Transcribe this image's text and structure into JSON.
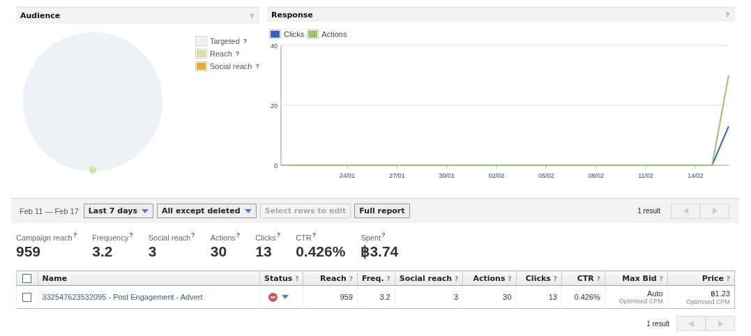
{
  "audience": {
    "title": "Audience",
    "help": "?",
    "legend": [
      {
        "label": "Targeted",
        "help": "?",
        "color": "#edf0f5"
      },
      {
        "label": "Reach",
        "help": "?",
        "color": "#cfe4a2"
      },
      {
        "label": "Social reach",
        "help": "?",
        "color": "#e8a82a"
      }
    ]
  },
  "response": {
    "title": "Response",
    "help": "?",
    "chart_data": {
      "type": "line",
      "legend": "top",
      "categories": [
        null,
        null,
        null,
        null,
        "24/01",
        null,
        null,
        "27/01",
        null,
        null,
        "30/01",
        null,
        null,
        "02/02",
        null,
        null,
        "05/02",
        null,
        null,
        "08/02",
        null,
        null,
        "11/02",
        null,
        null,
        "14/02",
        null,
        null
      ],
      "ylim": [
        0,
        40
      ],
      "yticks": [
        0,
        20,
        40
      ],
      "series": [
        {
          "name": "Clicks",
          "color": "#3a5fbd",
          "values": [
            null,
            null,
            null,
            null,
            null,
            null,
            null,
            null,
            null,
            null,
            null,
            null,
            null,
            null,
            null,
            null,
            null,
            null,
            null,
            null,
            null,
            null,
            null,
            null,
            null,
            null,
            0,
            13
          ]
        },
        {
          "name": "Actions",
          "color": "#9dc16a",
          "values": [
            0,
            0,
            0,
            0,
            0,
            0,
            0,
            0,
            0,
            0,
            0,
            0,
            0,
            0,
            0,
            0,
            0,
            0,
            0,
            0,
            0,
            0,
            0,
            0,
            0,
            0,
            0,
            30
          ]
        }
      ]
    }
  },
  "toolbar": {
    "date_range": "Feb 11 — Feb 17",
    "buttons": [
      {
        "label": "Last 7 days",
        "kind": "dropdown",
        "disabled": false
      },
      {
        "label": "All except deleted",
        "kind": "dropdown",
        "disabled": false
      },
      {
        "label": "Select rows to edit",
        "kind": "plain",
        "disabled": true
      },
      {
        "label": "Full report",
        "kind": "plain",
        "disabled": false
      }
    ],
    "result_count": "1 result"
  },
  "stats": [
    {
      "label": "Campaign reach",
      "help": "?",
      "value": "959"
    },
    {
      "label": "Frequency",
      "help": "?",
      "value": "3.2"
    },
    {
      "label": "Social reach",
      "help": "?",
      "value": "3"
    },
    {
      "label": "Actions",
      "help": "?",
      "value": "30"
    },
    {
      "label": "Clicks",
      "help": "?",
      "value": "13"
    },
    {
      "label": "CTR",
      "help": "?",
      "value": "0.426%"
    },
    {
      "label": "Spent",
      "help": "?",
      "value": "฿3.74"
    }
  ],
  "table": {
    "select_all": {
      "checked": false
    },
    "columns": [
      {
        "label": "Name"
      },
      {
        "label": "Status",
        "help": "?"
      },
      {
        "label": "Reach",
        "help": "?"
      },
      {
        "label": "Freq.",
        "help": "?"
      },
      {
        "label": "Social reach",
        "help": "?"
      },
      {
        "label": "Actions",
        "help": "?"
      },
      {
        "label": "Clicks",
        "help": "?"
      },
      {
        "label": "CTR",
        "help": "?"
      },
      {
        "label": "Max Bid",
        "help": "?"
      },
      {
        "label": "Price",
        "help": "?"
      }
    ],
    "rows": [
      {
        "checked": false,
        "name": "332547623532095 - Post Engagement - Advert",
        "active": false,
        "reach": "959",
        "freq": "3.2",
        "social_reach": "3",
        "actions": "30",
        "clicks": "13",
        "ctr": "0.426%",
        "max_bid": {
          "value": "Auto",
          "note": "Optimised CPM"
        },
        "price": {
          "value": "฿1.23",
          "note": "Optimised CPM"
        }
      }
    ]
  },
  "footer": {
    "result_count": "1 result"
  }
}
